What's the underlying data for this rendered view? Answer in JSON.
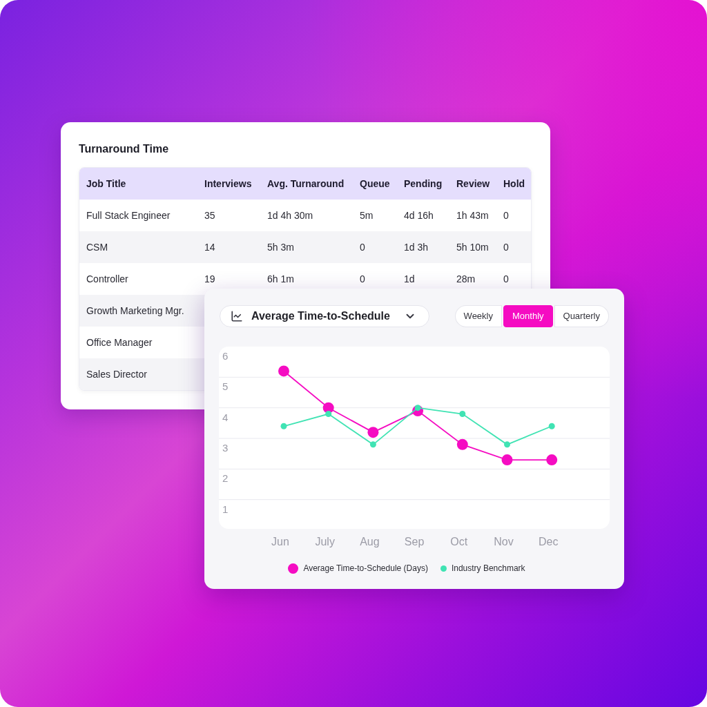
{
  "table_card": {
    "title": "Turnaround Time",
    "columns": [
      "Job Title",
      "Interviews",
      "Avg. Turnaround",
      "Queue",
      "Pending",
      "Review",
      "Hold"
    ],
    "rows": [
      {
        "cells": [
          "Full Stack Engineer",
          "35",
          "1d 4h 30m",
          "5m",
          "4d 16h",
          "1h 43m",
          "0"
        ]
      },
      {
        "cells": [
          "CSM",
          "14",
          "5h 3m",
          "0",
          "1d 3h",
          "5h 10m",
          "0"
        ]
      },
      {
        "cells": [
          "Controller",
          "19",
          "6h 1m",
          "0",
          "1d",
          "28m",
          "0"
        ]
      },
      {
        "cells": [
          "Growth Marketing Mgr."
        ]
      },
      {
        "cells": [
          "Office Manager"
        ]
      },
      {
        "cells": [
          "Sales Director"
        ]
      }
    ]
  },
  "chart_card": {
    "metric_dropdown": {
      "label": "Average Time-to-Schedule"
    },
    "period_tabs": [
      {
        "label": "Weekly",
        "selected": false
      },
      {
        "label": "Monthly",
        "selected": true
      },
      {
        "label": "Quarterly",
        "selected": false
      }
    ],
    "chart_data": {
      "type": "line",
      "categories": [
        "Jun",
        "July",
        "Aug",
        "Sep",
        "Oct",
        "Nov",
        "Dec"
      ],
      "series": [
        {
          "name": "Average Time-to-Schedule (Days)",
          "color": "#f50cc2",
          "marker": "o",
          "values": [
            5.2,
            4.0,
            3.2,
            3.9,
            2.8,
            2.3,
            2.3
          ]
        },
        {
          "name": "Industry Benchmark",
          "color": "#40e3b3",
          "marker": "o",
          "values": [
            3.4,
            3.8,
            2.8,
            4.0,
            3.8,
            2.8,
            3.4
          ]
        }
      ],
      "ylim": [
        0,
        6
      ],
      "yticks": [
        1,
        2,
        3,
        4,
        5,
        6
      ],
      "grid": true
    }
  }
}
